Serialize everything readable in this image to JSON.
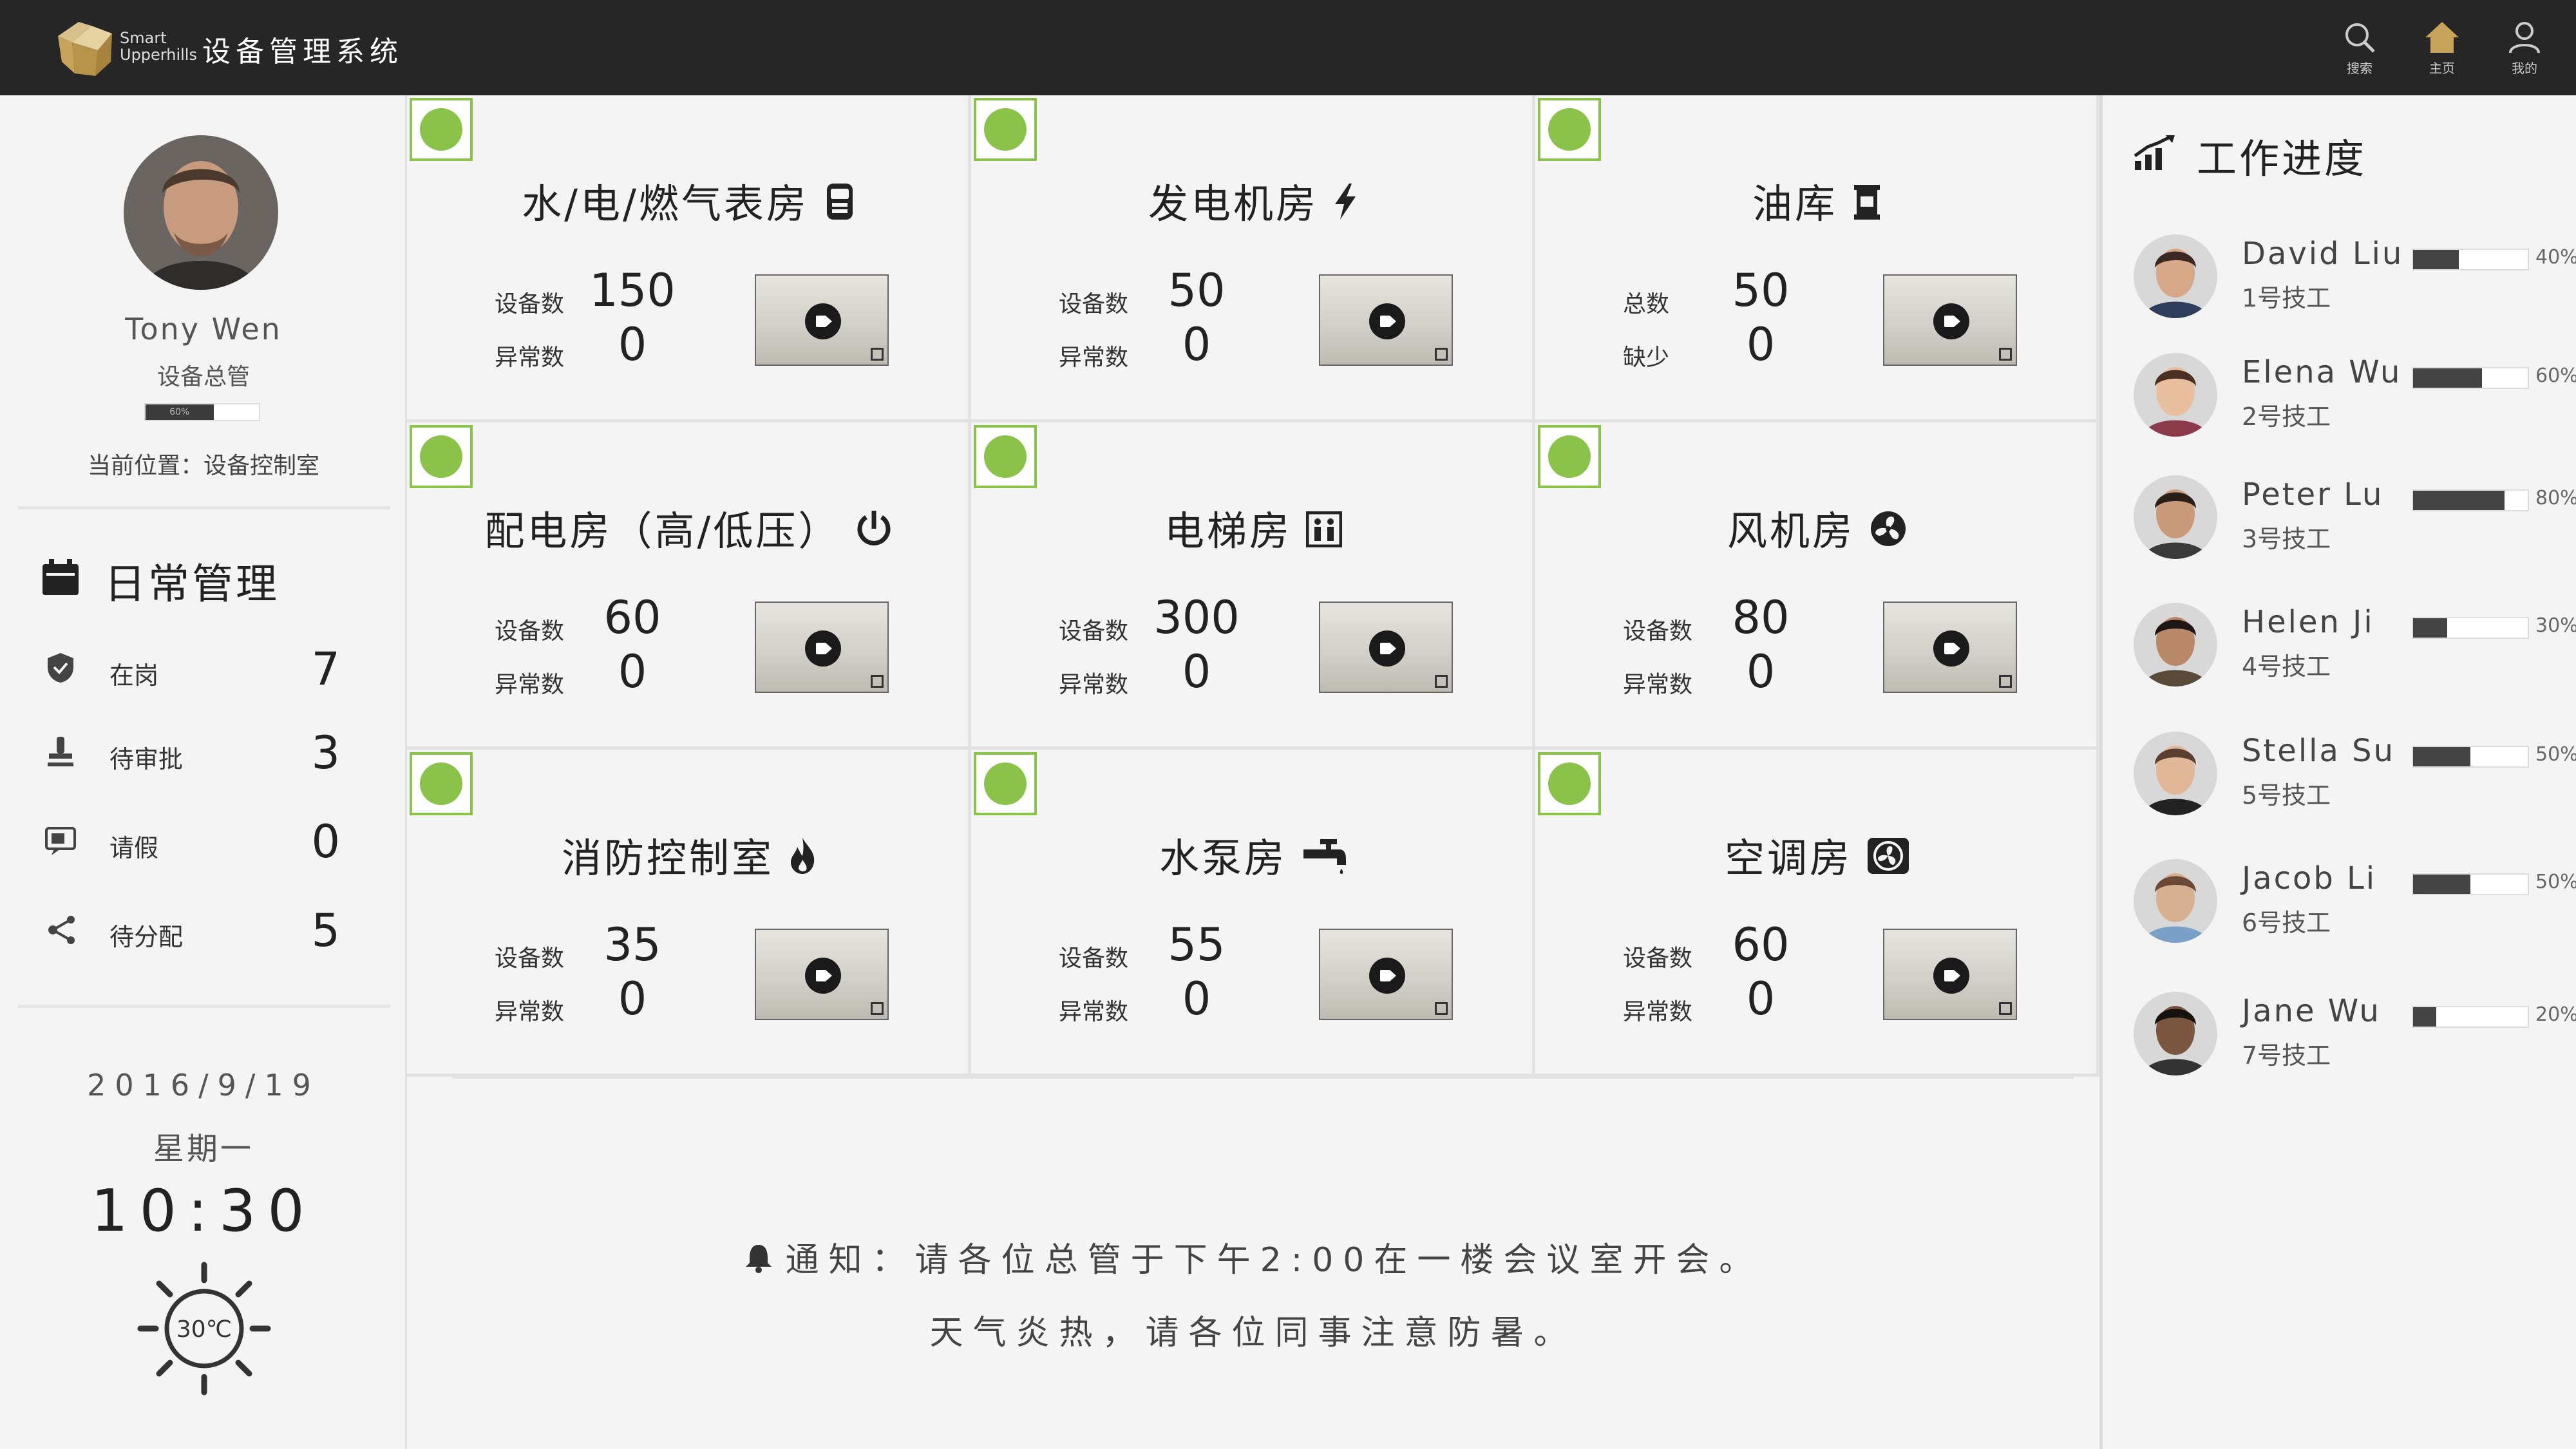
{
  "header": {
    "brand_line1": "Smart",
    "brand_line2": "Upperhills",
    "title": "设备管理系统",
    "nav": [
      {
        "label": "搜索",
        "icon": "search-icon"
      },
      {
        "label": "主页",
        "icon": "home-icon"
      },
      {
        "label": "我的",
        "icon": "user-icon"
      }
    ],
    "accent": "#c8a45a"
  },
  "profile": {
    "name": "Tony Wen",
    "role": "设备总管",
    "progress_label": "60%",
    "progress": 0.6,
    "location": "当前位置：设备控制室"
  },
  "daily": {
    "title": "日常管理",
    "items": [
      {
        "label": "在岗",
        "count": "7",
        "icon": "shield-icon"
      },
      {
        "label": "待审批",
        "count": "3",
        "icon": "stamp-icon"
      },
      {
        "label": "请假",
        "count": "0",
        "icon": "leave-icon"
      },
      {
        "label": "待分配",
        "count": "5",
        "icon": "share-icon"
      }
    ]
  },
  "datetime": {
    "date": "2016/9/19",
    "weekday": "星期一",
    "time": "10:30",
    "temperature": "30℃"
  },
  "rooms": [
    {
      "title": "水/电/燃气表房",
      "icon": "meter-icon",
      "label1": "设备数",
      "value1": "150",
      "label2": "异常数",
      "value2": "0"
    },
    {
      "title": "发电机房",
      "icon": "lightning-icon",
      "label1": "设备数",
      "value1": "50",
      "label2": "异常数",
      "value2": "0"
    },
    {
      "title": "油库",
      "icon": "oil-tank-icon",
      "label1": "总数",
      "value1": "50",
      "label2": "缺少",
      "value2": "0"
    },
    {
      "title": "配电房（高/低压）",
      "icon": "power-icon",
      "label1": "设备数",
      "value1": "60",
      "label2": "异常数",
      "value2": "0"
    },
    {
      "title": "电梯房",
      "icon": "elevator-icon",
      "label1": "设备数",
      "value1": "300",
      "label2": "异常数",
      "value2": "0"
    },
    {
      "title": "风机房",
      "icon": "fan-icon",
      "label1": "设备数",
      "value1": "80",
      "label2": "异常数",
      "value2": "0"
    },
    {
      "title": "消防控制室",
      "icon": "fire-icon",
      "label1": "设备数",
      "value1": "35",
      "label2": "异常数",
      "value2": "0"
    },
    {
      "title": "水泵房",
      "icon": "faucet-icon",
      "label1": "设备数",
      "value1": "55",
      "label2": "异常数",
      "value2": "0"
    },
    {
      "title": "空调房",
      "icon": "aircon-icon",
      "label1": "设备数",
      "value1": "60",
      "label2": "异常数",
      "value2": "0"
    }
  ],
  "notice": {
    "line1": "通知：请各位总管于下午2:00在一楼会议室开会。",
    "line2": "天气炎热，请各位同事注意防暑。"
  },
  "progress": {
    "title": "工作进度",
    "workers": [
      {
        "name": "David Liu",
        "role": "1号技工",
        "percent_label": "40%",
        "percent": 0.4
      },
      {
        "name": "Elena Wu",
        "role": "2号技工",
        "percent_label": "60%",
        "percent": 0.6
      },
      {
        "name": "Peter Lu",
        "role": "3号技工",
        "percent_label": "80%",
        "percent": 0.8
      },
      {
        "name": "Helen Ji",
        "role": "4号技工",
        "percent_label": "30%",
        "percent": 0.3
      },
      {
        "name": "Stella Su",
        "role": "5号技工",
        "percent_label": "50%",
        "percent": 0.5
      },
      {
        "name": "Jacob Li",
        "role": "6号技工",
        "percent_label": "50%",
        "percent": 0.5
      },
      {
        "name": "Jane Wu",
        "role": "7号技工",
        "percent_label": "20%",
        "percent": 0.2
      }
    ]
  }
}
